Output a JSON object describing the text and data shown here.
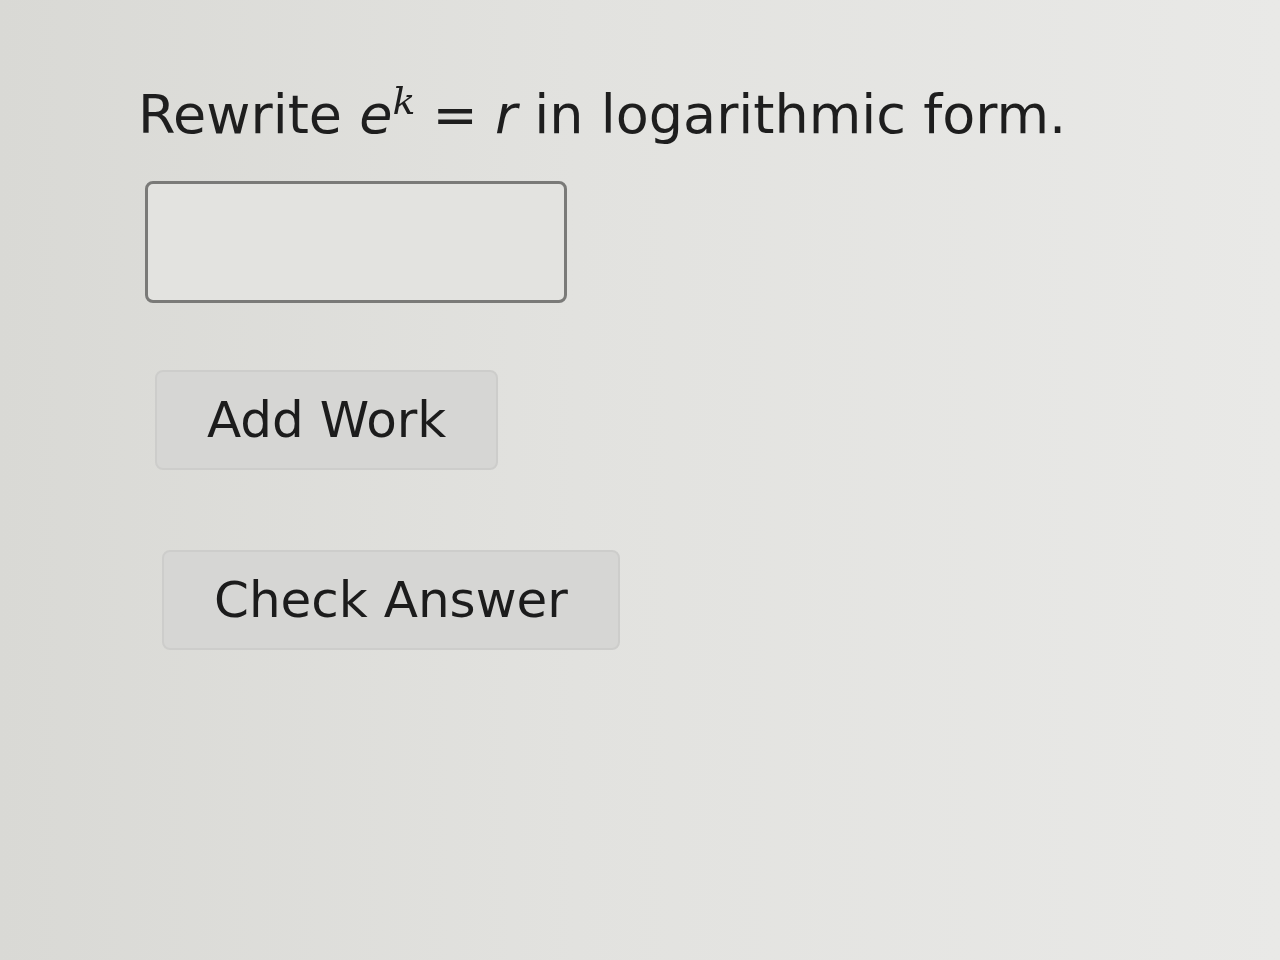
{
  "question": {
    "text": "Rewrite *e*$^{k}$ = *r* in logarithmic form."
  },
  "buttons": [
    {
      "label": "Add Work"
    },
    {
      "label": "Check Answer"
    }
  ]
}
